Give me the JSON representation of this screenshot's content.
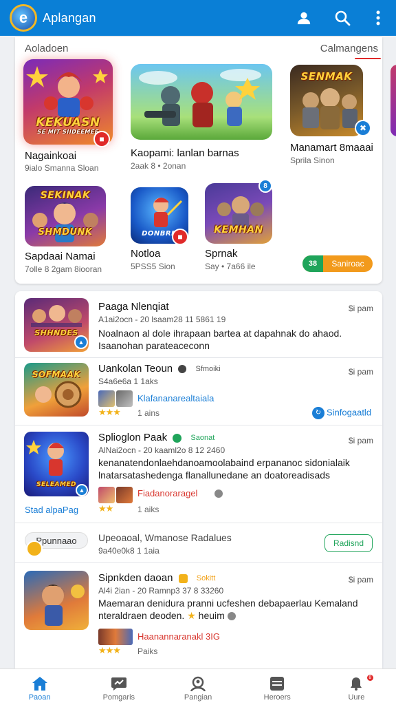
{
  "appbar": {
    "title": "Aplangan",
    "icons": [
      "account-icon",
      "search-icon",
      "more-vert-icon"
    ]
  },
  "featured": {
    "section_label": "Aoladoen",
    "more_label": "Calmangens",
    "tiles": [
      {
        "name": "Nagainkoai",
        "sub": "9ialo Smanna Sloan",
        "art_text": "KEKUASN",
        "art_sub": "SE MIT SIIDEEMEE"
      },
      {
        "name": "Kaopami: lanlan barnas",
        "sub": "2aak 8 • 2onan",
        "art_text": ""
      },
      {
        "name": "Manamart 8maaai",
        "sub": "Sprila Sinon",
        "art_text": "SENMAK"
      },
      {
        "name": "Sapdaai Namai",
        "sub": "7olle 8 2gam 8iooran",
        "art_text": "SEKINAK",
        "art_sub": "SHMDUNK"
      },
      {
        "name": "Notloa",
        "sub": "5PSS5 Sion",
        "art_text": "DONBRD"
      },
      {
        "name": "Sprnak",
        "sub": "Say • 7a66 ile",
        "art_text": "KEMHAN"
      }
    ],
    "action_button": {
      "prefix": "38",
      "label": "Saniroac"
    }
  },
  "list": [
    {
      "title": "Paaga Nlenqiat",
      "time": "$i pam",
      "meta": "A1ai2ocn - 20 lsaam28 11 5861 19",
      "desc": "Noalnaon al dole ihrapaan bartea at dapahnak do ahaod. Isaanohan parateaceconn",
      "thumb_text": "SHHNDES"
    },
    {
      "title": "Uankolan Teoun",
      "chip": "Sfmoiki",
      "time": "$i pam",
      "meta": "S4a6e6a 1 1aks",
      "link": "Klafananarealtaiala",
      "rating_text": "1 ains",
      "side_link": "Sinfogaatld",
      "thumb_text": "SOFMAAK"
    },
    {
      "title": "Splioglon Paak",
      "chip": "Saonat",
      "time": "$i pam",
      "meta": "AlNai2ocn - 20 kaaml2o 8 12 2460",
      "desc": "kenanatendonlaehdanoamoolabaind erpananoc sidonialaik lnatarsatashedenga flanallunedane an doatoreadisads",
      "link": "Fiadanoraragel",
      "rating_text": "1 aiks",
      "badge_text": "Stad alpaPag",
      "thumb_text": "SELEAMED"
    },
    {
      "title": "Upeoaoal, Wmanose Radalues",
      "time": "",
      "meta": "9a40e0k8 1 1aia",
      "pill": "Ppunnaao",
      "button": "Radisnd"
    },
    {
      "title": "Sipnkden daoan",
      "chip": "Sokitt",
      "time": "$i pam",
      "meta": "Al4i 2ian - 20 Ramnp3 37 8 33260",
      "desc": "Maemaran denidura pranni ucfeshen debapaerlau Kemaland",
      "desc2": "nteraldraen deoden.",
      "desc2_tail": "heuim",
      "link": "Haanannaranakl 3IG",
      "rating_text": "Paiks",
      "thumb_text": ""
    }
  ],
  "bottomnav": [
    {
      "label": "Paoan",
      "icon": "home-icon",
      "active": true
    },
    {
      "label": "Pomgaris",
      "icon": "chat-icon",
      "active": false
    },
    {
      "label": "Pangian",
      "icon": "person-search-icon",
      "active": false
    },
    {
      "label": "Heroers",
      "icon": "list-icon",
      "active": false
    },
    {
      "label": "Uure",
      "icon": "notifications-icon",
      "active": false,
      "badge": "8"
    }
  ],
  "colors": {
    "appbar": "#0a7fd6",
    "accent_blue": "#1a7ed6",
    "accent_red": "#d8362e",
    "accent_green": "#1fa45a",
    "accent_orange": "#f29a1c",
    "star": "#f2b21a"
  }
}
